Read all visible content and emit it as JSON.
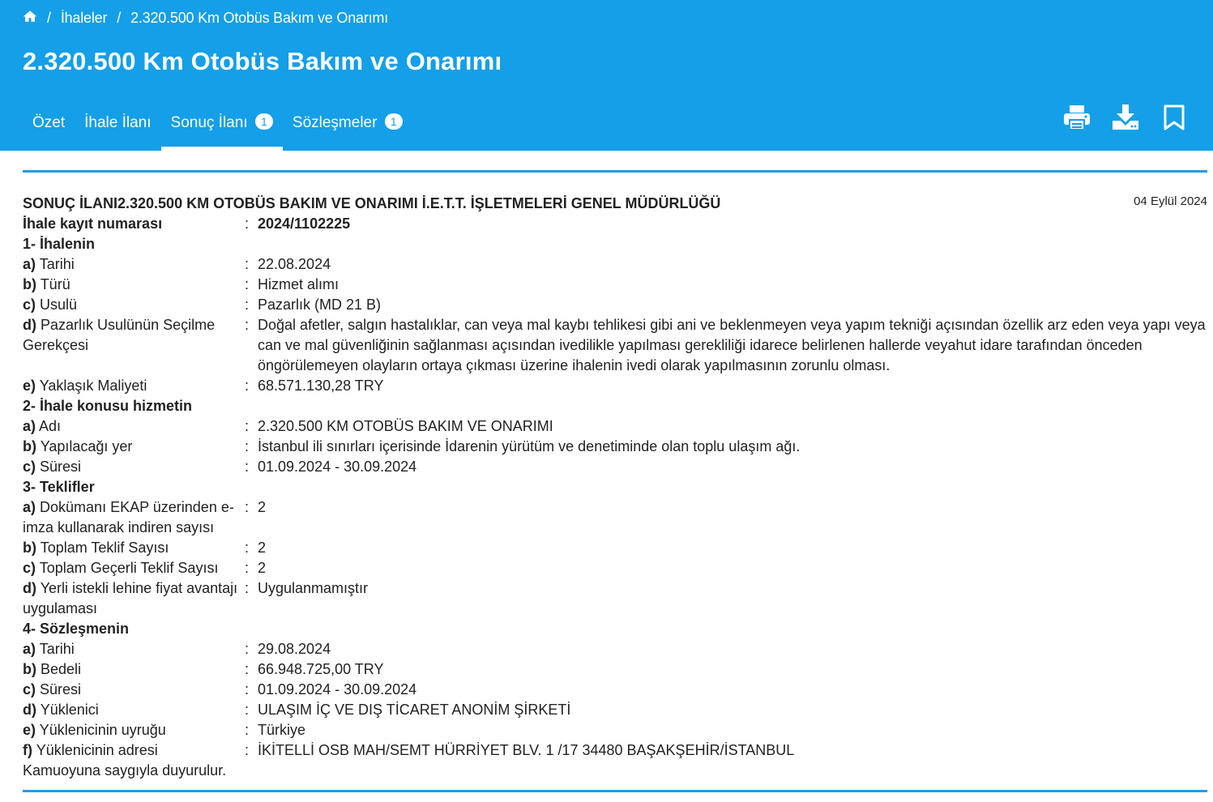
{
  "breadcrumb": {
    "home": "home",
    "sep1": "/",
    "item1": "İhaleler",
    "sep2": "/",
    "item2": "2.320.500 Km Otobüs Bakım ve Onarımı"
  },
  "page": {
    "title": "2.320.500 Km Otobüs Bakım ve Onarımı"
  },
  "tabs": [
    {
      "label": "Özet"
    },
    {
      "label": "İhale İlanı"
    },
    {
      "label": "Sonuç İlanı",
      "badge": "1"
    },
    {
      "label": "Sözleşmeler",
      "badge": "1"
    }
  ],
  "toolbar": {
    "icons": [
      "print-icon",
      "download-icon",
      "bookmark-icon"
    ]
  },
  "colors": {
    "header": "#149fe8",
    "rule": "#1c9ee6"
  },
  "document": {
    "heading": "SONUÇ İLANI2.320.500 KM OTOBÜS BAKIM VE ONARIMI İ.E.T.T. İŞLETMELERİ GENEL MÜDÜRLÜĞÜ",
    "date": "04 Eylül 2024",
    "registry": {
      "label": "İhale kayıt numarası",
      "value": "2024/1102225"
    },
    "s1": {
      "title": "1- İhalenin",
      "a_k": "a)",
      "a_l": "Tarihi",
      "a_v": "22.08.2024",
      "b_k": "b)",
      "b_l": "Türü",
      "b_v": "Hizmet alımı",
      "c_k": "c)",
      "c_l": "Usulü",
      "c_v": "Pazarlık (MD 21 B)",
      "d_k": "d)",
      "d_l": "Pazarlık Usulünün Seçilme Gerekçesi",
      "d_v": "Doğal afetler, salgın hastalıklar, can veya mal kaybı tehlikesi gibi ani ve beklenmeyen veya yapım tekniği açısından özellik arz eden veya yapı veya can ve mal güvenliğinin sağlanması açısından ivedilikle yapılması gerekliliği idarece belirlenen hallerde veyahut idare tarafından önceden öngörülemeyen olayların ortaya çıkması üzerine ihalenin ivedi olarak yapılmasının zorunlu olması.",
      "e_k": "e)",
      "e_l": "Yaklaşık Maliyeti",
      "e_v": "68.571.130,28 TRY"
    },
    "s2": {
      "title": "2- İhale konusu hizmetin",
      "a_k": "a)",
      "a_l": "Adı",
      "a_v": "2.320.500 KM OTOBÜS BAKIM VE ONARIMI",
      "b_k": "b)",
      "b_l": "Yapılacağı yer",
      "b_v": "İstanbul ili sınırları içerisinde İdarenin yürütüm ve denetiminde olan toplu ulaşım ağı.",
      "c_k": "c)",
      "c_l": "Süresi",
      "c_v": "01.09.2024 - 30.09.2024"
    },
    "s3": {
      "title": "3- Teklifler",
      "a_k": "a)",
      "a_l": "Dokümanı EKAP üzerinden e-imza kullanarak indiren sayısı",
      "a_v": "2",
      "b_k": "b)",
      "b_l": "Toplam Teklif Sayısı",
      "b_v": "2",
      "c_k": "c)",
      "c_l": "Toplam Geçerli Teklif Sayısı",
      "c_v": "2",
      "d_k": "d)",
      "d_l": "Yerli istekli lehine fiyat avantajı uygulaması",
      "d_v": "Uygulanmamıştır"
    },
    "s4": {
      "title": "4- Sözleşmenin",
      "a_k": "a)",
      "a_l": "Tarihi",
      "a_v": "29.08.2024",
      "b_k": "b)",
      "b_l": "Bedeli",
      "b_v": "66.948.725,00 TRY",
      "c_k": "c)",
      "c_l": "Süresi",
      "c_v": "01.09.2024 - 30.09.2024",
      "d_k": "d)",
      "d_l": "Yüklenici",
      "d_v": "ULAŞIM İÇ VE DIŞ TİCARET ANONİM ŞİRKETİ",
      "e_k": "e)",
      "e_l": "Yüklenicinin uyruğu",
      "e_v": "Türkiye",
      "f_k": "f)",
      "f_l": "Yüklenicinin adresi",
      "f_v": "İKİTELLİ OSB MAH/SEMT HÜRRİYET BLV. 1 /17 34480 BAŞAKŞEHİR/İSTANBUL"
    },
    "colon": ":",
    "closing": "Kamuoyuna saygıyla duyurulur."
  }
}
